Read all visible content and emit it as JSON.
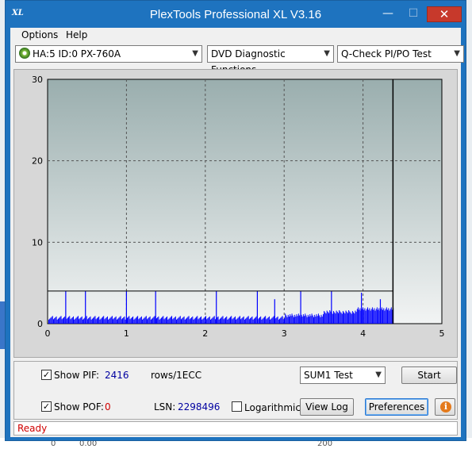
{
  "window": {
    "app_icon": "XL",
    "title": "PlexTools Professional XL V3.16",
    "minimize": "—",
    "maximize": "☐",
    "close": "✕"
  },
  "menu": {
    "options": "Options",
    "help": "Help"
  },
  "toolbar": {
    "drive": "HA:5 ID:0  PX-760A",
    "function": "DVD Diagnostic Functions",
    "test": "Q-Check PI/PO Test"
  },
  "chart_data": {
    "type": "bar",
    "xlim": [
      0,
      5
    ],
    "ylim": [
      0,
      30
    ],
    "x_ticks": [
      "0",
      "1",
      "2",
      "3",
      "4",
      "5"
    ],
    "y_ticks": [
      "0",
      "10",
      "20",
      "30"
    ],
    "grid": true,
    "end_marker_x": 4.38,
    "threshold_y": 4,
    "series_color": "#0000ff",
    "spikes": [
      {
        "x": 0.23,
        "y": 4
      },
      {
        "x": 0.48,
        "y": 4
      },
      {
        "x": 1.0,
        "y": 4
      },
      {
        "x": 1.37,
        "y": 4
      },
      {
        "x": 2.14,
        "y": 4
      },
      {
        "x": 2.66,
        "y": 4
      },
      {
        "x": 2.88,
        "y": 3
      },
      {
        "x": 3.21,
        "y": 4
      },
      {
        "x": 3.6,
        "y": 4
      },
      {
        "x": 3.98,
        "y": 3.8
      },
      {
        "x": 4.22,
        "y": 3
      }
    ]
  },
  "controls": {
    "show_pif_label": "Show PIF:",
    "pif_value": "2416",
    "pif_unit": "rows/1ECC",
    "show_pof_label": "Show POF:",
    "pof_value": "0",
    "lsn_label": "LSN:",
    "lsn_value": "2298496",
    "logarithmic_label": "Logarithmic",
    "sum_select": "SUM1 Test",
    "start_button": "Start",
    "view_log_button": "View Log",
    "preferences_button": "Preferences",
    "info_glyph": "i",
    "check_glyph": "✓"
  },
  "status": {
    "text": "Ready"
  },
  "background": {
    "left_value": "0",
    "mid_value": "0.00",
    "right_value": "200"
  }
}
